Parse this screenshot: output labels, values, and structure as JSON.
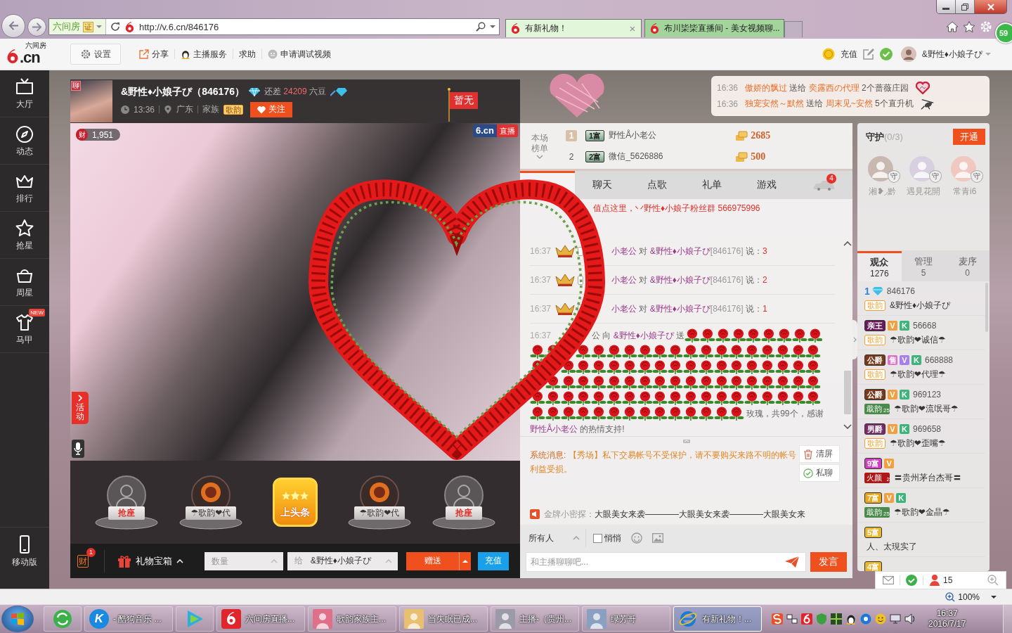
{
  "browser": {
    "site": "六间房",
    "cert": "证",
    "url": "http://v.6.cn/846176",
    "tabs": [
      {
        "label": "有新礼物！",
        "selected": true,
        "close": "×"
      },
      {
        "label": "布川枈枈直播间 - 美女视频聊...",
        "selected": false
      }
    ],
    "badge": "59"
  },
  "toolbar": {
    "logo_text": ".cn",
    "logo_sub": "六间房",
    "settings": "设置",
    "links": [
      "分享",
      "主播服务",
      "求助",
      "申请调试视频"
    ],
    "recharge": "充值",
    "user": "&野性♦小娘子ぴ"
  },
  "sidebar": {
    "items": [
      {
        "label": "大厅",
        "selected": false
      },
      {
        "label": "动态",
        "selected": false
      },
      {
        "label": "排行",
        "selected": false
      },
      {
        "label": "抢星",
        "selected": false
      },
      {
        "label": "周星",
        "selected": false
      },
      {
        "label": "马甲",
        "selected": false,
        "badge": "NEW"
      }
    ],
    "mobile": "移动版"
  },
  "anchor": {
    "avatar_badge": "聊",
    "name": "&野性♦小娘子ぴ（846176）",
    "gap_label": "还差",
    "gap_value": "24209",
    "gap_unit": "六豆",
    "time": "13:36",
    "location": "广东",
    "family_label": "家族",
    "family_badge": "歌韵",
    "follow": "关注",
    "flag": "暂无"
  },
  "video": {
    "wealth_icon": "财",
    "wealth": "1,951",
    "logo": "6.cn",
    "live": "直播",
    "activity": "活动"
  },
  "seats": [
    {
      "kind": "empty",
      "label": "抢座"
    },
    {
      "kind": "user",
      "label": "☂歌韵❤代"
    },
    {
      "kind": "headline",
      "label": "上头条"
    },
    {
      "kind": "user",
      "label": "☂歌韵❤代"
    },
    {
      "kind": "empty",
      "label": "抢座"
    }
  ],
  "gift_bar": {
    "wealth_icon": "财",
    "wealth_count": "1",
    "gift_box": "礼物宝箱",
    "quantity_placeholder": "数量",
    "to_label": "给",
    "to_value": "&野性♦小娘子ぴ",
    "send": "赠送",
    "recharge": "充值"
  },
  "notifications": [
    {
      "time": "16:36",
      "sender": "傲娇的飘过",
      "verb": "送给",
      "receiver": "奕露西の代理",
      "gift": "2个蔷薇庄园"
    },
    {
      "time": "16:36",
      "sender": "独宠安然～默然",
      "verb": "送给",
      "receiver": "周末见~安然",
      "gift": "5个直升机"
    }
  ],
  "chat": {
    "ranking": {
      "label": "本场榜单",
      "rows": [
        {
          "kind": "medal",
          "rank": "1",
          "badge": "1富",
          "name": "野性Å小老公",
          "amount": "2685"
        },
        {
          "kind": "plain",
          "rank": "2",
          "badge": "2富",
          "name": "微信_5626886",
          "amount": "500"
        }
      ]
    },
    "tabs": [
      {
        "selected": true
      },
      {
        "label": "聊天",
        "selected": false
      },
      {
        "label": "点歌",
        "selected": false
      },
      {
        "label": "礼单",
        "selected": false
      },
      {
        "label": "游戏",
        "selected": false
      }
    ],
    "car_badge": "4",
    "notice": "值点这里，丷野性♦小娘子粉丝群 566975996",
    "messages": [
      {
        "kind": "say",
        "time": "16:37",
        "sender": "小老公",
        "verb": "对",
        "target": "&野性♦小娘子ぴ",
        "target_id": "[846176]",
        "says": "说：",
        "content": "3"
      },
      {
        "kind": "say",
        "time": "16:37",
        "sender": "小老公",
        "verb": "对",
        "target": "&野性♦小娘子ぴ",
        "target_id": "[846176]",
        "says": "说：",
        "content": "2"
      },
      {
        "kind": "say",
        "time": "16:37",
        "sender": "小老公",
        "verb": "对",
        "target": "&野性♦小娘子ぴ",
        "target_id": "[846176]",
        "says": "说：",
        "content": "1"
      },
      {
        "kind": "gift",
        "time": "16:37",
        "sender": "公",
        "verb": "向",
        "target": "&野性♦小娘子ぴ",
        "action": "送",
        "gift": "玫瑰，共99个，感谢",
        "thanks_name": "野性Å小老公",
        "thanks": "的热情支持!"
      }
    ],
    "system": {
      "label": "系统消息:",
      "lines": [
        "【秀场】私下交易帐号不受保护，请不要购买来路不明的帐号",
        "利益受损。"
      ]
    },
    "tools": [
      "清屏",
      "私聊"
    ],
    "ticker": {
      "label": "金牌小密探：",
      "text": "大眼美女来袭————大眼美女来袭————大眼美女来"
    },
    "input": {
      "audience": "所有人",
      "whisper": {
        "label": "悄悄",
        "checked": false
      },
      "placeholder": "和主播聊聊吧...",
      "send": "发言"
    }
  },
  "guardians": {
    "title": "守护",
    "count": "(0/3)",
    "open": "开通",
    "members": [
      {
        "name": "湘❥◞黔",
        "badge": "守"
      },
      {
        "name": "遇見花開",
        "badge": "守"
      },
      {
        "name": "常青i6",
        "badge": "守"
      }
    ]
  },
  "audience_tabs": [
    {
      "label": "观众",
      "count": "1276",
      "selected": true
    },
    {
      "label": "管理",
      "count": "5",
      "selected": false
    },
    {
      "label": "麦序",
      "count": "0",
      "selected": false
    }
  ],
  "audience": [
    {
      "badges": [
        {
          "kind": "num",
          "text": "1"
        },
        {
          "kind": "diamond"
        }
      ],
      "id": "846176",
      "family": {
        "kind": "outline",
        "text": "歌韵",
        "color": "#f0a030"
      },
      "name": "&野性♦小娘子ぴ"
    },
    {
      "badges": [
        {
          "kind": "rank",
          "text": "亲王",
          "color": "#6a1a5a"
        },
        {
          "kind": "letter",
          "text": "V",
          "color": "#f0a040"
        },
        {
          "kind": "letter",
          "text": "K",
          "color": "#3cb47a"
        }
      ],
      "id": "56668",
      "family": {
        "kind": "outline",
        "text": "歌韵",
        "color": "#f0a030"
      },
      "name": "☂歌韵❤诚信☂"
    },
    {
      "badges": [
        {
          "kind": "rank",
          "text": "公爵",
          "color": "#7a3a1a"
        },
        {
          "kind": "letter",
          "text": "售",
          "color": "#e070c8"
        },
        {
          "kind": "letter",
          "text": "V",
          "color": "#a87ee8"
        },
        {
          "kind": "letter",
          "text": "K",
          "color": "#3cb47a"
        }
      ],
      "id": "668888",
      "family": {
        "kind": "outline",
        "text": "歌韵",
        "color": "#f0a030"
      },
      "name": "☂歌韵❤代理☂"
    },
    {
      "badges": [
        {
          "kind": "rank",
          "text": "公爵",
          "color": "#7a3a1a"
        },
        {
          "kind": "letter",
          "text": "V",
          "color": "#f0a040"
        },
        {
          "kind": "letter",
          "text": "K",
          "color": "#3cb47a"
        }
      ],
      "id": "969123",
      "family": {
        "kind": "filled",
        "text": "戢韵",
        "sub": "25",
        "color": "#4a8a4a"
      },
      "name": "☂歌韵❤流氓哥☂"
    },
    {
      "badges": [
        {
          "kind": "rank",
          "text": "男爵",
          "color": "#7a2a6a"
        },
        {
          "kind": "letter",
          "text": "V",
          "color": "#f0a040"
        },
        {
          "kind": "letter",
          "text": "K",
          "color": "#3cb47a"
        }
      ],
      "id": "969658",
      "family": {
        "kind": "outline",
        "text": "歌韵",
        "color": "#f0a030"
      },
      "name": "☂歌韵❤歪嘴☂"
    },
    {
      "badges": [
        {
          "kind": "rank",
          "text": "9富",
          "color": "#d040c0"
        },
        {
          "kind": "letter",
          "text": "V",
          "color": "#f0a040"
        }
      ],
      "family": {
        "kind": "filled",
        "text": "火颜",
        "sub": "2",
        "color": "#b01818"
      },
      "name": "〓贵州茅台杰哥〓"
    },
    {
      "badges": [
        {
          "kind": "rank",
          "text": "7富",
          "color": "#e8a818"
        },
        {
          "kind": "letter",
          "text": "V",
          "color": "#f0a040"
        },
        {
          "kind": "letter",
          "text": "K",
          "color": "#3cb47a"
        }
      ],
      "family": {
        "kind": "filled",
        "text": "戢韵",
        "sub": "25",
        "color": "#4a8a4a"
      },
      "name": "☂歌韵❤金晶☂"
    },
    {
      "badges": [
        {
          "kind": "rank",
          "text": "5富",
          "color": "#eab830"
        }
      ],
      "name": "人、太現实了"
    },
    {
      "badges": [
        {
          "kind": "rank",
          "text": "4富",
          "color": "#eab830"
        }
      ]
    }
  ],
  "mini_bar": {
    "count": "15"
  },
  "status_bar": {
    "zoom": "100%"
  },
  "taskbar": {
    "apps": [
      {
        "selected": false
      },
      {
        "glyph": "K",
        "label": "- 酷狗音乐 ...",
        "selected": false
      },
      {
        "selected": false
      },
      {
        "label": "六间房直播...",
        "selected": false
      },
      {
        "label": "歌韵家族主...",
        "selected": false
      },
      {
        "label": "当失眠已成...",
        "selected": false
      },
      {
        "label": "主播-（贵州...",
        "selected": false
      },
      {
        "label": "绿芳哥",
        "selected": false
      },
      {
        "label": "有新礼物！...",
        "selected": true
      }
    ],
    "time": "16:37",
    "date": "2016/7/17"
  }
}
